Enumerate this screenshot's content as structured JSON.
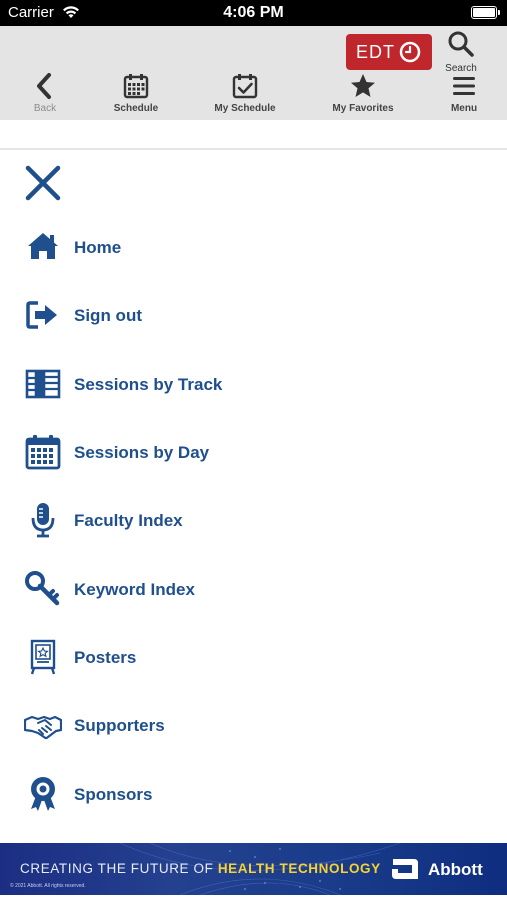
{
  "status_bar": {
    "carrier": "Carrier",
    "time": "4:06 PM"
  },
  "toolbar": {
    "edt_label": "EDT",
    "search_label": "Search",
    "back_label": "Back",
    "schedule_label": "Schedule",
    "my_schedule_label": "My Schedule",
    "my_favorites_label": "My Favorites",
    "menu_label": "Menu"
  },
  "menu": {
    "items": [
      {
        "label": "Home",
        "icon": "home-icon"
      },
      {
        "label": "Sign out",
        "icon": "sign-out-icon"
      },
      {
        "label": "Sessions by Track",
        "icon": "track-list-icon"
      },
      {
        "label": "Sessions by Day",
        "icon": "calendar-icon"
      },
      {
        "label": "Faculty Index",
        "icon": "microphone-icon"
      },
      {
        "label": "Keyword Index",
        "icon": "key-icon"
      },
      {
        "label": "Posters",
        "icon": "poster-easel-icon"
      },
      {
        "label": "Supporters",
        "icon": "handshake-icon"
      },
      {
        "label": "Sponsors",
        "icon": "award-ribbon-icon"
      }
    ]
  },
  "banner": {
    "text_prefix": "CREATING THE FUTURE OF ",
    "text_highlight": "HEALTH TECHNOLOGY",
    "brand": "Abbott",
    "fine_print": "© 2021 Abbott. All rights reserved."
  },
  "colors": {
    "menu_blue": "#1f4f8c",
    "edt_red": "#c0272d",
    "toolbar_gray": "#e4e4e4",
    "banner_highlight": "#f6d233"
  }
}
